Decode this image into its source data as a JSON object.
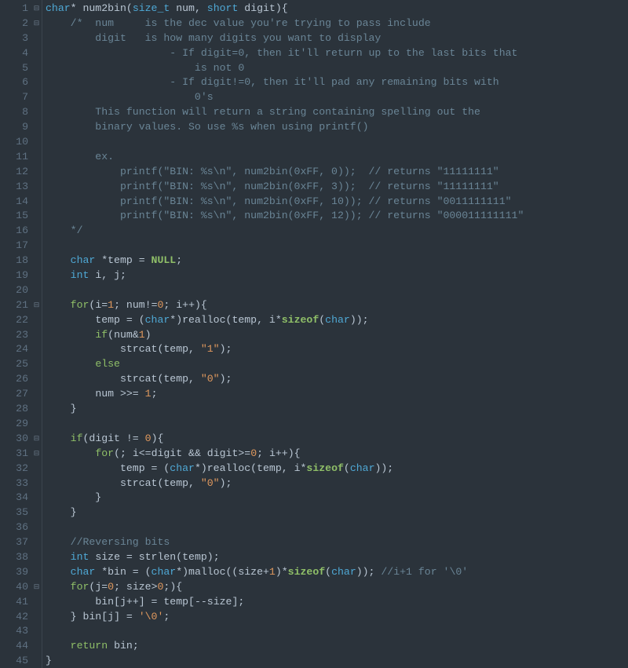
{
  "lineCount": 45,
  "foldMarkers": {
    "1": "⊟",
    "2": "⊟",
    "21": "⊟",
    "30": "⊟",
    "31": "⊟",
    "40": "⊟"
  },
  "lines": [
    {
      "n": 1,
      "tokens": [
        {
          "c": "t-type",
          "t": "char"
        },
        {
          "c": "t-op",
          "t": "* "
        },
        {
          "c": "t-func",
          "t": "num2bin"
        },
        {
          "c": "t-op",
          "t": "("
        },
        {
          "c": "t-type",
          "t": "size_t"
        },
        {
          "c": "t-op",
          "t": " "
        },
        {
          "c": "t-ident",
          "t": "num"
        },
        {
          "c": "t-op",
          "t": ", "
        },
        {
          "c": "t-type",
          "t": "short"
        },
        {
          "c": "t-op",
          "t": " "
        },
        {
          "c": "t-ident",
          "t": "digit"
        },
        {
          "c": "t-op",
          "t": "){"
        }
      ]
    },
    {
      "n": 2,
      "tokens": [
        {
          "c": "t-comment",
          "t": "    /*  num     is the dec value you're trying to pass include"
        }
      ]
    },
    {
      "n": 3,
      "tokens": [
        {
          "c": "t-comment",
          "t": "        digit   is how many digits you want to display"
        }
      ]
    },
    {
      "n": 4,
      "tokens": [
        {
          "c": "t-comment",
          "t": "                    - If digit=0, then it'll return up to the last bits that"
        }
      ]
    },
    {
      "n": 5,
      "tokens": [
        {
          "c": "t-comment",
          "t": "                        is not 0"
        }
      ]
    },
    {
      "n": 6,
      "tokens": [
        {
          "c": "t-comment",
          "t": "                    - If digit!=0, then it'll pad any remaining bits with"
        }
      ]
    },
    {
      "n": 7,
      "tokens": [
        {
          "c": "t-comment",
          "t": "                        0's"
        }
      ]
    },
    {
      "n": 8,
      "tokens": [
        {
          "c": "t-comment",
          "t": "        This function will return a string containing spelling out the"
        }
      ]
    },
    {
      "n": 9,
      "tokens": [
        {
          "c": "t-comment",
          "t": "        binary values. So use %s when using printf()"
        }
      ]
    },
    {
      "n": 10,
      "tokens": [
        {
          "c": "t-comment",
          "t": ""
        }
      ]
    },
    {
      "n": 11,
      "tokens": [
        {
          "c": "t-comment",
          "t": "        ex."
        }
      ]
    },
    {
      "n": 12,
      "tokens": [
        {
          "c": "t-comment",
          "t": "            printf(\"BIN: %s\\n\", num2bin(0xFF, 0));  // returns \"11111111\""
        }
      ]
    },
    {
      "n": 13,
      "tokens": [
        {
          "c": "t-comment",
          "t": "            printf(\"BIN: %s\\n\", num2bin(0xFF, 3));  // returns \"11111111\""
        }
      ]
    },
    {
      "n": 14,
      "tokens": [
        {
          "c": "t-comment",
          "t": "            printf(\"BIN: %s\\n\", num2bin(0xFF, 10)); // returns \"0011111111\""
        }
      ]
    },
    {
      "n": 15,
      "tokens": [
        {
          "c": "t-comment",
          "t": "            printf(\"BIN: %s\\n\", num2bin(0xFF, 12)); // returns \"000011111111\""
        }
      ]
    },
    {
      "n": 16,
      "tokens": [
        {
          "c": "t-comment",
          "t": "    */"
        }
      ]
    },
    {
      "n": 17,
      "tokens": [
        {
          "c": "t-default",
          "t": ""
        }
      ]
    },
    {
      "n": 18,
      "tokens": [
        {
          "c": "t-default",
          "t": "    "
        },
        {
          "c": "t-type",
          "t": "char"
        },
        {
          "c": "t-op",
          "t": " *"
        },
        {
          "c": "t-ident",
          "t": "temp"
        },
        {
          "c": "t-op",
          "t": " = "
        },
        {
          "c": "t-null",
          "t": "NULL"
        },
        {
          "c": "t-op",
          "t": ";"
        }
      ]
    },
    {
      "n": 19,
      "tokens": [
        {
          "c": "t-default",
          "t": "    "
        },
        {
          "c": "t-type",
          "t": "int"
        },
        {
          "c": "t-op",
          "t": " "
        },
        {
          "c": "t-ident",
          "t": "i"
        },
        {
          "c": "t-op",
          "t": ", "
        },
        {
          "c": "t-ident",
          "t": "j"
        },
        {
          "c": "t-op",
          "t": ";"
        }
      ]
    },
    {
      "n": 20,
      "tokens": [
        {
          "c": "t-default",
          "t": ""
        }
      ]
    },
    {
      "n": 21,
      "tokens": [
        {
          "c": "t-default",
          "t": "    "
        },
        {
          "c": "t-kw",
          "t": "for"
        },
        {
          "c": "t-op",
          "t": "("
        },
        {
          "c": "t-ident",
          "t": "i"
        },
        {
          "c": "t-op",
          "t": "="
        },
        {
          "c": "t-num",
          "t": "1"
        },
        {
          "c": "t-op",
          "t": "; "
        },
        {
          "c": "t-ident",
          "t": "num"
        },
        {
          "c": "t-op",
          "t": "!="
        },
        {
          "c": "t-num",
          "t": "0"
        },
        {
          "c": "t-op",
          "t": "; "
        },
        {
          "c": "t-ident",
          "t": "i"
        },
        {
          "c": "t-op",
          "t": "++){"
        }
      ]
    },
    {
      "n": 22,
      "tokens": [
        {
          "c": "t-default",
          "t": "        "
        },
        {
          "c": "t-ident",
          "t": "temp"
        },
        {
          "c": "t-op",
          "t": " = ("
        },
        {
          "c": "t-type",
          "t": "char"
        },
        {
          "c": "t-op",
          "t": "*)"
        },
        {
          "c": "t-func",
          "t": "realloc"
        },
        {
          "c": "t-op",
          "t": "("
        },
        {
          "c": "t-ident",
          "t": "temp"
        },
        {
          "c": "t-op",
          "t": ", "
        },
        {
          "c": "t-ident",
          "t": "i"
        },
        {
          "c": "t-op",
          "t": "*"
        },
        {
          "c": "t-sizeof",
          "t": "sizeof"
        },
        {
          "c": "t-op",
          "t": "("
        },
        {
          "c": "t-type",
          "t": "char"
        },
        {
          "c": "t-op",
          "t": "));"
        }
      ]
    },
    {
      "n": 23,
      "tokens": [
        {
          "c": "t-default",
          "t": "        "
        },
        {
          "c": "t-kw",
          "t": "if"
        },
        {
          "c": "t-op",
          "t": "("
        },
        {
          "c": "t-ident",
          "t": "num"
        },
        {
          "c": "t-op",
          "t": "&"
        },
        {
          "c": "t-num",
          "t": "1"
        },
        {
          "c": "t-op",
          "t": ")"
        }
      ]
    },
    {
      "n": 24,
      "tokens": [
        {
          "c": "t-default",
          "t": "            "
        },
        {
          "c": "t-func",
          "t": "strcat"
        },
        {
          "c": "t-op",
          "t": "("
        },
        {
          "c": "t-ident",
          "t": "temp"
        },
        {
          "c": "t-op",
          "t": ", "
        },
        {
          "c": "t-str",
          "t": "\"1\""
        },
        {
          "c": "t-op",
          "t": ");"
        }
      ]
    },
    {
      "n": 25,
      "tokens": [
        {
          "c": "t-default",
          "t": "        "
        },
        {
          "c": "t-kw",
          "t": "else"
        }
      ]
    },
    {
      "n": 26,
      "tokens": [
        {
          "c": "t-default",
          "t": "            "
        },
        {
          "c": "t-func",
          "t": "strcat"
        },
        {
          "c": "t-op",
          "t": "("
        },
        {
          "c": "t-ident",
          "t": "temp"
        },
        {
          "c": "t-op",
          "t": ", "
        },
        {
          "c": "t-str",
          "t": "\"0\""
        },
        {
          "c": "t-op",
          "t": ");"
        }
      ]
    },
    {
      "n": 27,
      "tokens": [
        {
          "c": "t-default",
          "t": "        "
        },
        {
          "c": "t-ident",
          "t": "num"
        },
        {
          "c": "t-op",
          "t": " >>= "
        },
        {
          "c": "t-num",
          "t": "1"
        },
        {
          "c": "t-op",
          "t": ";"
        }
      ]
    },
    {
      "n": 28,
      "tokens": [
        {
          "c": "t-default",
          "t": "    }"
        }
      ]
    },
    {
      "n": 29,
      "tokens": [
        {
          "c": "t-default",
          "t": ""
        }
      ]
    },
    {
      "n": 30,
      "tokens": [
        {
          "c": "t-default",
          "t": "    "
        },
        {
          "c": "t-kw",
          "t": "if"
        },
        {
          "c": "t-op",
          "t": "("
        },
        {
          "c": "t-ident",
          "t": "digit"
        },
        {
          "c": "t-op",
          "t": " != "
        },
        {
          "c": "t-num",
          "t": "0"
        },
        {
          "c": "t-op",
          "t": "){"
        }
      ]
    },
    {
      "n": 31,
      "tokens": [
        {
          "c": "t-default",
          "t": "        "
        },
        {
          "c": "t-kw",
          "t": "for"
        },
        {
          "c": "t-op",
          "t": "(; "
        },
        {
          "c": "t-ident",
          "t": "i"
        },
        {
          "c": "t-op",
          "t": "<="
        },
        {
          "c": "t-ident",
          "t": "digit"
        },
        {
          "c": "t-op",
          "t": " && "
        },
        {
          "c": "t-ident",
          "t": "digit"
        },
        {
          "c": "t-op",
          "t": ">="
        },
        {
          "c": "t-num",
          "t": "0"
        },
        {
          "c": "t-op",
          "t": "; "
        },
        {
          "c": "t-ident",
          "t": "i"
        },
        {
          "c": "t-op",
          "t": "++){"
        }
      ]
    },
    {
      "n": 32,
      "tokens": [
        {
          "c": "t-default",
          "t": "            "
        },
        {
          "c": "t-ident",
          "t": "temp"
        },
        {
          "c": "t-op",
          "t": " = ("
        },
        {
          "c": "t-type",
          "t": "char"
        },
        {
          "c": "t-op",
          "t": "*)"
        },
        {
          "c": "t-func",
          "t": "realloc"
        },
        {
          "c": "t-op",
          "t": "("
        },
        {
          "c": "t-ident",
          "t": "temp"
        },
        {
          "c": "t-op",
          "t": ", "
        },
        {
          "c": "t-ident",
          "t": "i"
        },
        {
          "c": "t-op",
          "t": "*"
        },
        {
          "c": "t-sizeof",
          "t": "sizeof"
        },
        {
          "c": "t-op",
          "t": "("
        },
        {
          "c": "t-type",
          "t": "char"
        },
        {
          "c": "t-op",
          "t": "));"
        }
      ]
    },
    {
      "n": 33,
      "tokens": [
        {
          "c": "t-default",
          "t": "            "
        },
        {
          "c": "t-func",
          "t": "strcat"
        },
        {
          "c": "t-op",
          "t": "("
        },
        {
          "c": "t-ident",
          "t": "temp"
        },
        {
          "c": "t-op",
          "t": ", "
        },
        {
          "c": "t-str",
          "t": "\"0\""
        },
        {
          "c": "t-op",
          "t": ");"
        }
      ]
    },
    {
      "n": 34,
      "tokens": [
        {
          "c": "t-default",
          "t": "        }"
        }
      ]
    },
    {
      "n": 35,
      "tokens": [
        {
          "c": "t-default",
          "t": "    }"
        }
      ]
    },
    {
      "n": 36,
      "tokens": [
        {
          "c": "t-default",
          "t": ""
        }
      ]
    },
    {
      "n": 37,
      "tokens": [
        {
          "c": "t-default",
          "t": "    "
        },
        {
          "c": "t-comment",
          "t": "//Reversing bits"
        }
      ]
    },
    {
      "n": 38,
      "tokens": [
        {
          "c": "t-default",
          "t": "    "
        },
        {
          "c": "t-type",
          "t": "int"
        },
        {
          "c": "t-op",
          "t": " "
        },
        {
          "c": "t-ident",
          "t": "size"
        },
        {
          "c": "t-op",
          "t": " = "
        },
        {
          "c": "t-func",
          "t": "strlen"
        },
        {
          "c": "t-op",
          "t": "("
        },
        {
          "c": "t-ident",
          "t": "temp"
        },
        {
          "c": "t-op",
          "t": ");"
        }
      ]
    },
    {
      "n": 39,
      "tokens": [
        {
          "c": "t-default",
          "t": "    "
        },
        {
          "c": "t-type",
          "t": "char"
        },
        {
          "c": "t-op",
          "t": " *"
        },
        {
          "c": "t-ident",
          "t": "bin"
        },
        {
          "c": "t-op",
          "t": " = ("
        },
        {
          "c": "t-type",
          "t": "char"
        },
        {
          "c": "t-op",
          "t": "*)"
        },
        {
          "c": "t-func",
          "t": "malloc"
        },
        {
          "c": "t-op",
          "t": "(("
        },
        {
          "c": "t-ident",
          "t": "size"
        },
        {
          "c": "t-op",
          "t": "+"
        },
        {
          "c": "t-num",
          "t": "1"
        },
        {
          "c": "t-op",
          "t": ")*"
        },
        {
          "c": "t-sizeof",
          "t": "sizeof"
        },
        {
          "c": "t-op",
          "t": "("
        },
        {
          "c": "t-type",
          "t": "char"
        },
        {
          "c": "t-op",
          "t": ")); "
        },
        {
          "c": "t-comment",
          "t": "//i+1 for '\\0'"
        }
      ]
    },
    {
      "n": 40,
      "tokens": [
        {
          "c": "t-default",
          "t": "    "
        },
        {
          "c": "t-kw",
          "t": "for"
        },
        {
          "c": "t-op",
          "t": "("
        },
        {
          "c": "t-ident",
          "t": "j"
        },
        {
          "c": "t-op",
          "t": "="
        },
        {
          "c": "t-num",
          "t": "0"
        },
        {
          "c": "t-op",
          "t": "; "
        },
        {
          "c": "t-ident",
          "t": "size"
        },
        {
          "c": "t-op",
          "t": ">"
        },
        {
          "c": "t-num",
          "t": "0"
        },
        {
          "c": "t-op",
          "t": ";){"
        }
      ]
    },
    {
      "n": 41,
      "tokens": [
        {
          "c": "t-default",
          "t": "        "
        },
        {
          "c": "t-ident",
          "t": "bin"
        },
        {
          "c": "t-op",
          "t": "["
        },
        {
          "c": "t-ident",
          "t": "j"
        },
        {
          "c": "t-op",
          "t": "++] = "
        },
        {
          "c": "t-ident",
          "t": "temp"
        },
        {
          "c": "t-op",
          "t": "[--"
        },
        {
          "c": "t-ident",
          "t": "size"
        },
        {
          "c": "t-op",
          "t": "];"
        }
      ]
    },
    {
      "n": 42,
      "tokens": [
        {
          "c": "t-default",
          "t": "    } "
        },
        {
          "c": "t-ident",
          "t": "bin"
        },
        {
          "c": "t-op",
          "t": "["
        },
        {
          "c": "t-ident",
          "t": "j"
        },
        {
          "c": "t-op",
          "t": "] = "
        },
        {
          "c": "t-str",
          "t": "'\\0'"
        },
        {
          "c": "t-op",
          "t": ";"
        }
      ]
    },
    {
      "n": 43,
      "tokens": [
        {
          "c": "t-default",
          "t": ""
        }
      ]
    },
    {
      "n": 44,
      "tokens": [
        {
          "c": "t-default",
          "t": "    "
        },
        {
          "c": "t-kw",
          "t": "return"
        },
        {
          "c": "t-op",
          "t": " "
        },
        {
          "c": "t-ident",
          "t": "bin"
        },
        {
          "c": "t-op",
          "t": ";"
        }
      ]
    },
    {
      "n": 45,
      "tokens": [
        {
          "c": "t-default",
          "t": "}"
        }
      ]
    }
  ]
}
